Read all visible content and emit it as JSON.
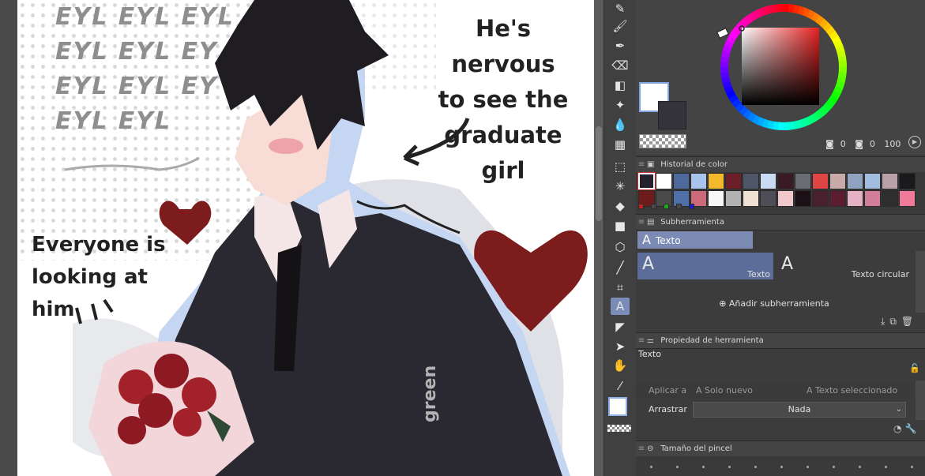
{
  "artwork": {
    "pattern_text": [
      "EYL EYL EYL",
      "EYL EYL EY",
      "EYL EYL EY",
      "EYL EYL"
    ],
    "caption_nervous": [
      "He's nervous",
      "to see the",
      "graduate girl"
    ],
    "caption_looking": [
      "Everyone is",
      "looking at him"
    ],
    "signature": "green"
  },
  "color_wheel": {
    "main_color": "#ffffff",
    "sub_color": "#34323b",
    "readout": [
      "0",
      "0",
      "100"
    ]
  },
  "color_history": {
    "title": "Historial de color",
    "row1": [
      "#25222e",
      "#ffffff",
      "#4e6a9c",
      "#a8c4ec",
      "#f3b92b",
      "#6d1e28",
      "#4f5667",
      "#c9dcf4",
      "#3a1a24",
      "#6a6d74",
      "#e04545",
      "#c8aaa8",
      "#8fa3c0",
      "#a3bde0",
      "#b9a1a9",
      "#1a1a1e"
    ],
    "row2": [
      "#6e1b1b",
      "#4a4a4a",
      "#4f6fa8",
      "#cc6a7b",
      "#f7f7f7",
      "#b2b2b2",
      "#efe0d4",
      "#4e4e58",
      "#f0c8cc",
      "#1c1016",
      "#4a2030",
      "#5b1e30",
      "#e4b2c4",
      "#d27e98",
      "#2e2e2e",
      "#f07a9a"
    ],
    "row3": [
      "#c1211f",
      "#4a4a4a",
      "#1da61d",
      "#4a4a4a",
      "#1d1dcc"
    ]
  },
  "subtool": {
    "title": "Subherramienta",
    "active_tab": "Texto",
    "items": [
      "Texto",
      "Texto circular"
    ],
    "add_label": "Añadir subherramienta"
  },
  "tool_property": {
    "title": "Propiedad de herramienta",
    "tool_name": "Texto",
    "apply_label": "Aplicar a",
    "apply_option1": "Solo nuevo",
    "apply_option2": "Texto seleccionado",
    "drag_label": "Arrastrar",
    "drag_value": "Nada"
  },
  "brush_size": {
    "title": "Tamaño del pincel"
  }
}
